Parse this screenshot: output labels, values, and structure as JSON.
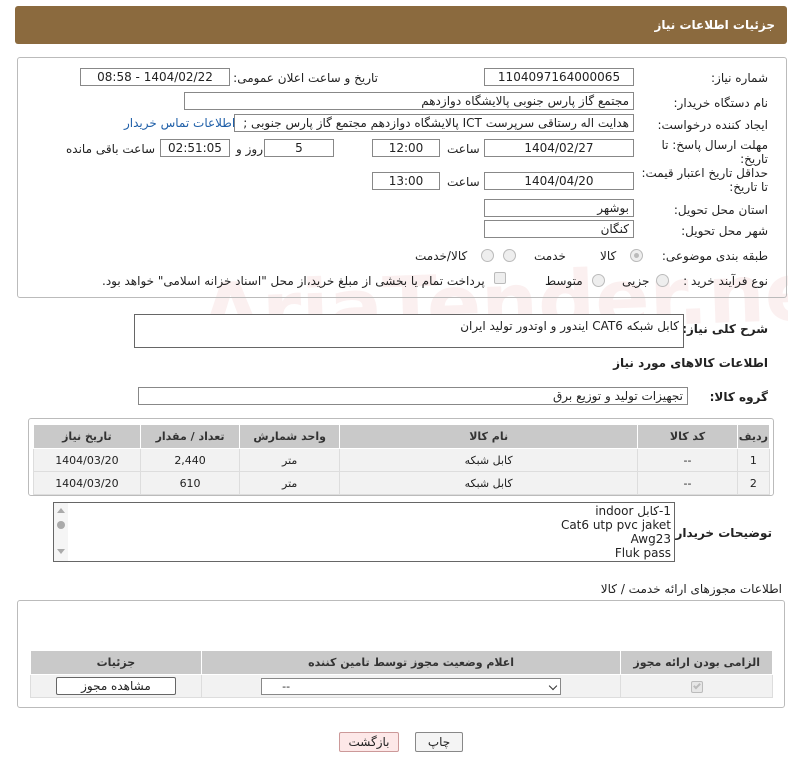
{
  "title": "جزئیات اطلاعات نیاز",
  "watermark": "AriaTender.neT",
  "form": {
    "need_number_label": "شماره نیاز:",
    "need_number": "1104097164000065",
    "announce_label": "تاریخ و ساعت اعلان عمومی:",
    "announce_value": "1404/02/22 - 08:58",
    "buyer_org_label": "نام دستگاه خریدار:",
    "buyer_org": "مجتمع گاز پارس جنوبی  پالایشگاه دوازدهم",
    "creator_label": "ایجاد کننده درخواست:",
    "creator": "هدایت اله رستاقی سرپرست ICT پالایشگاه دوازدهم  مجتمع گاز پارس جنوبی  ;",
    "contact_link": "اطلاعات تماس خریدار",
    "deadline_label": "مهلت ارسال پاسخ: تا تاریخ:",
    "deadline_date": "1404/02/27",
    "time_label": "ساعت",
    "deadline_time": "12:00",
    "days_value": "5",
    "days_label": "روز و",
    "remaining_value": "02:51:05",
    "remaining_label": "ساعت باقی مانده",
    "min_price_label": "حداقل تاریخ اعتبار قیمت: تا تاریخ:",
    "min_price_date": "1404/04/20",
    "min_price_time": "13:00",
    "province_label": "استان محل تحویل:",
    "province": "بوشهر",
    "city_label": "شهر محل تحویل:",
    "city": "کنگان",
    "category_label": "طبقه بندی موضوعی:",
    "category_options": [
      "کالا",
      "خدمت",
      "کالا/خدمت"
    ],
    "category_selected": "کالا",
    "process_label": "نوع فرآیند خرید :",
    "process_options": [
      "جزیی",
      "متوسط"
    ],
    "process_note": "پرداخت تمام یا بخشی از مبلغ خرید،از محل \"اسناد خزانه اسلامی\" خواهد بود."
  },
  "description": {
    "label": "شرح کلی نیاز:",
    "value": "کابل شبکه CAT6   ایندور و اوتدور تولید ایران"
  },
  "goods": {
    "section_title": "اطلاعات کالاهای مورد نیاز",
    "group_label": "گروه کالا:",
    "group_value": "تجهیزات تولید و توزیع برق",
    "headers": [
      "ردیف",
      "کد کالا",
      "نام کالا",
      "واحد شمارش",
      "تعداد / مقدار",
      "تاریخ نیاز"
    ],
    "rows": [
      [
        "1",
        "--",
        "کابل شبکه",
        "متر",
        "2,440",
        "1404/03/20"
      ],
      [
        "2",
        "--",
        "کابل شبکه",
        "متر",
        "610",
        "1404/03/20"
      ]
    ]
  },
  "buyer_notes": {
    "label": "توضیحات خریدار:",
    "lines": [
      "1-کابل indoor",
      "Cat6 utp pvc jaket",
      "Awg23",
      "Fluk pass"
    ]
  },
  "permits": {
    "section_title": "اطلاعات مجوزهای ارائه خدمت / کالا",
    "headers": [
      "الزامی بودن ارائه مجوز",
      "اعلام وضعیت مجوز توسط تامین کننده",
      "جزئیات"
    ],
    "select_value": "--",
    "view_button": "مشاهده مجوز"
  },
  "buttons": {
    "print": "چاپ",
    "back": "بازگشت"
  }
}
